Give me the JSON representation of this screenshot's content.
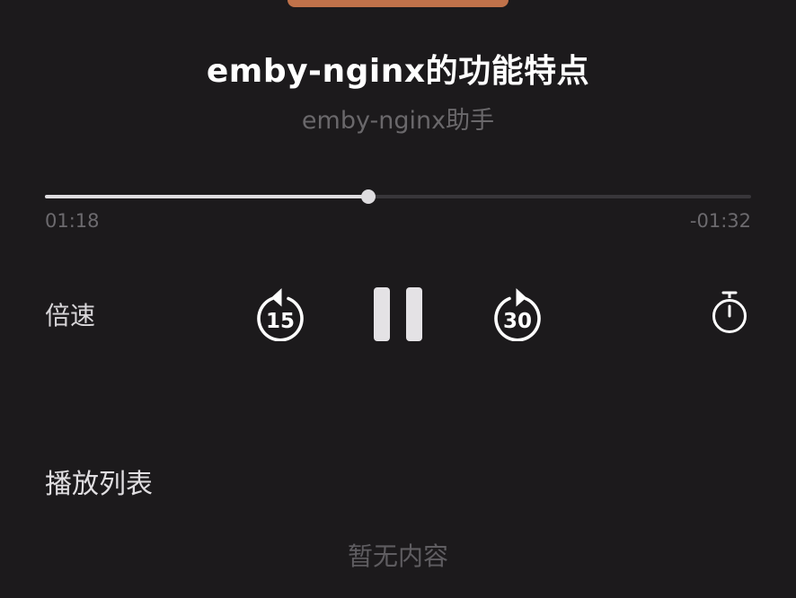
{
  "track": {
    "title": "emby-nginx的功能特点",
    "album": "emby-nginx助手",
    "progress_fraction": 0.458
  },
  "time": {
    "elapsed": "01:18",
    "remaining": "-01:32"
  },
  "controls": {
    "speed_label": "倍速",
    "rewind_seconds": "15",
    "forward_seconds": "30"
  },
  "playlist": {
    "title": "播放列表",
    "empty_text": "暂无内容"
  },
  "colors": {
    "background": "#1c1a1c",
    "artwork_accent": "#c0724a",
    "progress_fill": "#dedcdf",
    "progress_track": "#38363a"
  },
  "icons": [
    "rewind-15-icon",
    "pause-icon",
    "forward-30-icon",
    "timer-icon"
  ]
}
